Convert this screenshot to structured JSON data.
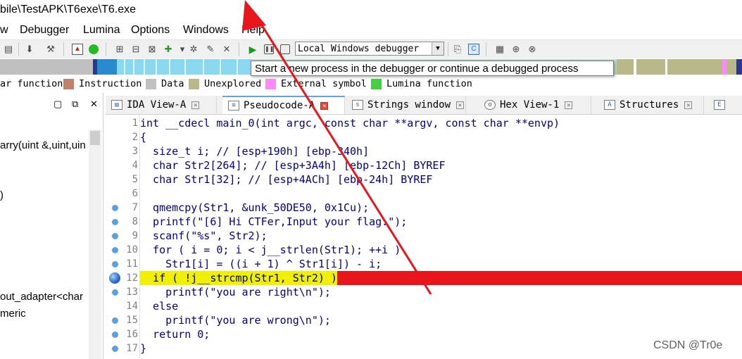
{
  "window": {
    "title": "bile\\TestAPK\\T6exe\\T6.exe"
  },
  "menu": {
    "items": [
      "w",
      "Debugger",
      "Lumina",
      "Options",
      "Windows",
      "Help"
    ]
  },
  "toolbar": {
    "debugger_select": "Local Windows debugger",
    "tooltip": "Start a new process in the debugger or continue a debugged process"
  },
  "legend": {
    "items": [
      {
        "label": "ar function",
        "color": ""
      },
      {
        "label": "Instruction",
        "color": "#c0806a"
      },
      {
        "label": "Data",
        "color": "#c0c0c0"
      },
      {
        "label": "Unexplored",
        "color": "#b8b88a"
      },
      {
        "label": "External symbol",
        "color": "#ff88ff"
      },
      {
        "label": "Lumina function",
        "color": "#40d040"
      }
    ]
  },
  "left_panel": {
    "items": [
      "arry(uint &,uint,uin",
      ")",
      "out_adapter<char",
      "meric"
    ]
  },
  "tabs": [
    {
      "label": "IDA View-A",
      "icon": "ida-view-icon",
      "active": false
    },
    {
      "label": "Pseudocode-A",
      "icon": "pseudocode-icon",
      "active": true
    },
    {
      "label": "Strings window",
      "icon": "strings-icon",
      "active": false
    },
    {
      "label": "Hex View-1",
      "icon": "hex-view-icon",
      "active": false
    },
    {
      "label": "Structures",
      "icon": "structures-icon",
      "active": false
    }
  ],
  "code": {
    "breakpoint_line": 12,
    "lines": [
      {
        "n": "1",
        "text": "int __cdecl main_0(int argc, const char **argv, const char **envp)",
        "dot": false
      },
      {
        "n": "2",
        "text": "{",
        "dot": false
      },
      {
        "n": "3",
        "text": "  size_t i; // [esp+190h] [ebp-340h]",
        "dot": false
      },
      {
        "n": "4",
        "text": "  char Str2[264]; // [esp+3A4h] [ebp-12Ch] BYREF",
        "dot": false
      },
      {
        "n": "5",
        "text": "  char Str1[32]; // [esp+4ACh] [ebp-24h] BYREF",
        "dot": false
      },
      {
        "n": "6",
        "text": "",
        "dot": false
      },
      {
        "n": "7",
        "text": "  qmemcpy(Str1, &unk_50DE50, 0x1Cu);",
        "dot": true
      },
      {
        "n": "8",
        "text": "  printf(\"[6] Hi CTFer,Input your flag:\");",
        "dot": true
      },
      {
        "n": "9",
        "text": "  scanf(\"%s\", Str2);",
        "dot": true
      },
      {
        "n": "10",
        "text": "  for ( i = 0; i < j__strlen(Str1); ++i )",
        "dot": true
      },
      {
        "n": "11",
        "text": "    Str1[i] = ((i + 1) ^ Str1[i]) - i;",
        "dot": true
      },
      {
        "n": "12",
        "text": "  if ( !j__strcmp(Str1, Str2) )",
        "dot": false
      },
      {
        "n": "13",
        "text": "    printf(\"you are right\\n\");",
        "dot": true
      },
      {
        "n": "14",
        "text": "  else",
        "dot": false
      },
      {
        "n": "15",
        "text": "    printf(\"you are wrong\\n\");",
        "dot": true
      },
      {
        "n": "16",
        "text": "  return 0;",
        "dot": true
      },
      {
        "n": "17",
        "text": "}",
        "dot": true
      }
    ]
  },
  "watermark": "CSDN @Tr0e",
  "colors": {
    "highlight_line": "#e8161b",
    "annotation_arrow": "#e8161b",
    "breakpoint": "#2f6fd0"
  }
}
